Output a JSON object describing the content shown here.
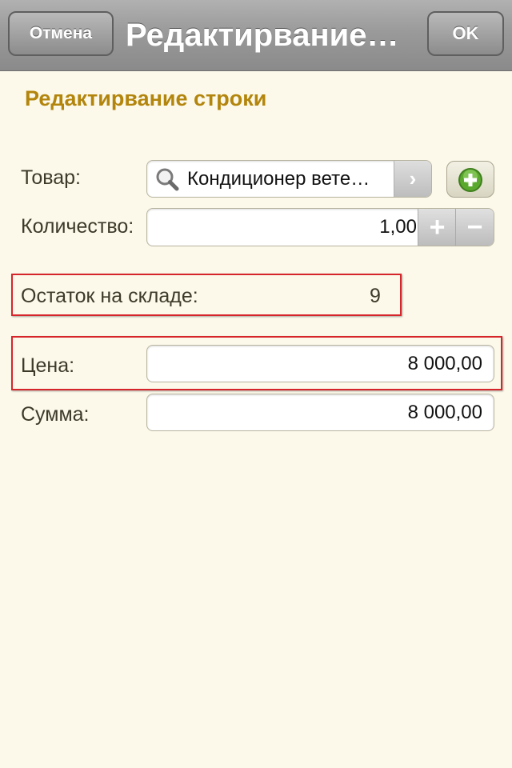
{
  "navbar": {
    "cancel_label": "Отмена",
    "title": "Редактирвание…",
    "ok_label": "OK"
  },
  "page_heading": "Редактирвание строки",
  "form": {
    "product": {
      "label": "Товар:",
      "value": "Кондиционер вете…",
      "chevron": "›"
    },
    "quantity": {
      "label": "Количество:",
      "value": "1,00",
      "plus": "+",
      "minus": "−"
    },
    "stock": {
      "label": "Остаток на складе:",
      "value": "9"
    },
    "price": {
      "label": "Цена:",
      "value": "8 000,00"
    },
    "sum": {
      "label": "Сумма:",
      "value": "8 000,00"
    }
  },
  "icons": {
    "search": "search-icon",
    "chevron": "chevron-right-icon",
    "add": "plus-circle-icon"
  },
  "colors": {
    "background": "#fcf9ea",
    "heading": "#b3850d",
    "highlight": "#d7262b",
    "add_green": "#5aa82e"
  }
}
